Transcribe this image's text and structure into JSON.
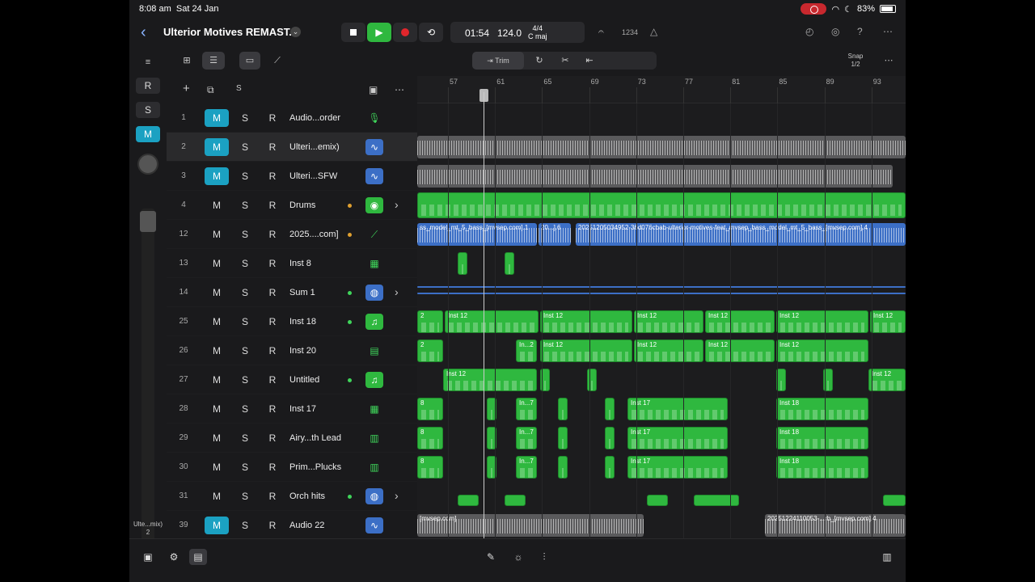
{
  "status": {
    "time": "8:08 am",
    "date": "Sat 24 Jan",
    "battery": "83%"
  },
  "header": {
    "title": "Ulterior Motives REMAST...",
    "time": "01:54",
    "bpm": "124.0",
    "signature": "4/4",
    "key": "C maj",
    "count_in": "1234"
  },
  "toolbar": {
    "trim_label": "Trim",
    "snap_label": "Snap",
    "snap_value": "1/2"
  },
  "rail": {
    "buttons": [
      "R",
      "S",
      "M"
    ],
    "track_label": "Ulte...mix)",
    "track_num": "2"
  },
  "header_tools": {
    "solo_label": "S"
  },
  "tracks": [
    {
      "num": "1",
      "name": "Audio...order",
      "m": true,
      "icon": "mic-icon",
      "dot": ""
    },
    {
      "num": "2",
      "name": "Ulteri...emix)",
      "m": true,
      "icon": "waveform-icon",
      "dot": ""
    },
    {
      "num": "3",
      "name": "Ulteri...SFW",
      "m": true,
      "icon": "waveform-icon",
      "dot": ""
    },
    {
      "num": "4",
      "name": "Drums",
      "m": false,
      "icon": "drum-icon",
      "dot": "#e0a030",
      "expand": true
    },
    {
      "num": "12",
      "name": "2025....com]",
      "m": false,
      "icon": "guitar-icon",
      "dot": "#e0a030"
    },
    {
      "num": "13",
      "name": "Inst 8",
      "m": false,
      "icon": "keyboard-icon",
      "dot": ""
    },
    {
      "num": "14",
      "name": "Sum 1",
      "m": false,
      "icon": "stack-icon",
      "dot": "#3fd45a",
      "expand": true
    },
    {
      "num": "25",
      "name": "Inst 18",
      "m": false,
      "icon": "note-icon",
      "dot": "#3fd45a"
    },
    {
      "num": "26",
      "name": "Inst 20",
      "m": false,
      "icon": "organ-icon",
      "dot": ""
    },
    {
      "num": "27",
      "name": "Untitled",
      "m": false,
      "icon": "note-icon",
      "dot": "#3fd45a"
    },
    {
      "num": "28",
      "name": "Inst 17",
      "m": false,
      "icon": "keyboard-icon",
      "dot": ""
    },
    {
      "num": "29",
      "name": "Airy...th Lead",
      "m": false,
      "icon": "synth-icon",
      "dot": ""
    },
    {
      "num": "30",
      "name": "Prim...Plucks",
      "m": false,
      "icon": "synth-icon",
      "dot": ""
    },
    {
      "num": "31",
      "name": "Orch hits",
      "m": false,
      "icon": "stack-icon",
      "dot": "#3fd45a",
      "expand": true
    },
    {
      "num": "39",
      "name": "Audio 22",
      "m": true,
      "icon": "waveform-icon",
      "dot": ""
    }
  ],
  "ruler": [
    "57",
    "61",
    "65",
    "69",
    "73",
    "77",
    "81",
    "85",
    "89",
    "93"
  ],
  "regions": {
    "bass_1": "ss_model_mt_5_bass_[mvsep.com].1",
    "bass_2": "20...].6",
    "bass_3": "20251205034952-36d076cbab-ulterior-motives-feat_mvsep_bass_model_mt_5_bass_[mvsep.com].4",
    "inst12": "Inst 12",
    "inst12_short": "In...2",
    "inst17": "Inst 17",
    "inst17_short": "In...7",
    "inst18": "Inst 18",
    "num2": "2",
    "num8": "8",
    "audio22_a": "[mvsep.com]",
    "audio22_b": "20251224110053-...rb_[mvsep.com].4"
  }
}
